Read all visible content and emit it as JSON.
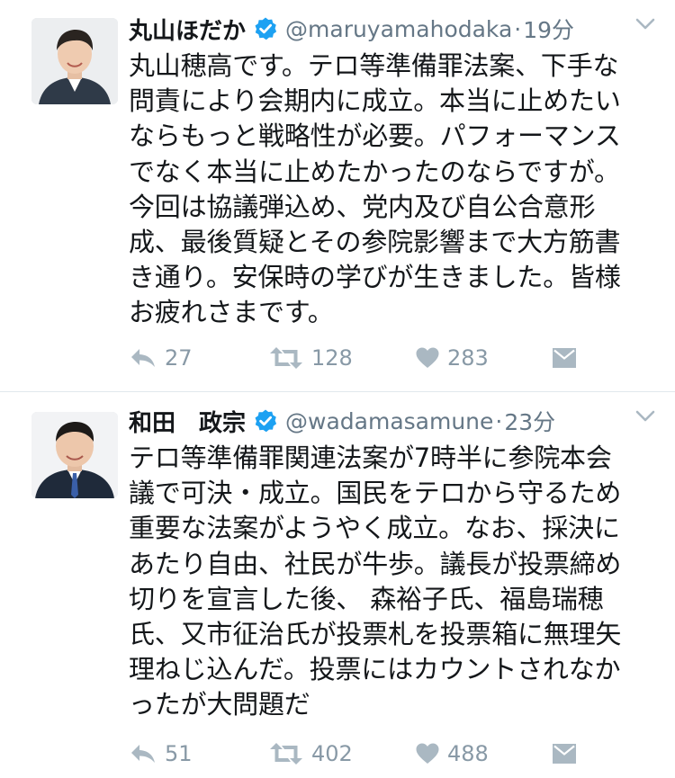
{
  "tweets": [
    {
      "name": "丸山ほだか",
      "handle": "@maruyamahodaka",
      "separator": "·",
      "time": "19分",
      "lines": [
        "丸山穂高です。テロ等準備罪法案、下手な",
        "問責により会期内に成立。本当に止めたい",
        "ならもっと戦略性が必要。パフォーマンス",
        "でなく本当に止めたかったのならですが。",
        "今回は協議弾込め、党内及び自公合意形",
        "成、最後質疑とその参院影響まで大方筋書",
        "き通り。安保時の学びが生きました。皆様",
        "お疲れさまです。"
      ],
      "replies": "27",
      "retweets": "128",
      "likes": "283"
    },
    {
      "name": "和田　政宗",
      "handle": "@wadamasamune",
      "separator": "·",
      "time": "23分",
      "lines": [
        "テロ等準備罪関連法案が7時半に参院本会",
        "議で可決・成立。国民をテロから守るため",
        "重要な法案がようやく成立。なお、採決に",
        "あたり自由、社民が牛歩。議長が投票締め",
        "切りを宣言した後、 森裕子氏、福島瑞穂",
        "氏、又市征治氏が投票札を投票箱に無理矢",
        "理ねじ込んだ。投票にはカウントされなか",
        "ったが大問題だ"
      ],
      "replies": "51",
      "retweets": "402",
      "likes": "488"
    }
  ],
  "icons": {
    "verified": "verified-badge-icon",
    "chevron": "chevron-down-icon",
    "reply": "reply-icon",
    "retweet": "retweet-icon",
    "like": "heart-icon",
    "dm": "direct-message-icon"
  },
  "colors": {
    "verified": "#1da1f2",
    "icon_gray": "#aab8c2",
    "count_gray": "#8899a6",
    "meta_gray": "#657786",
    "text": "#14171a"
  }
}
